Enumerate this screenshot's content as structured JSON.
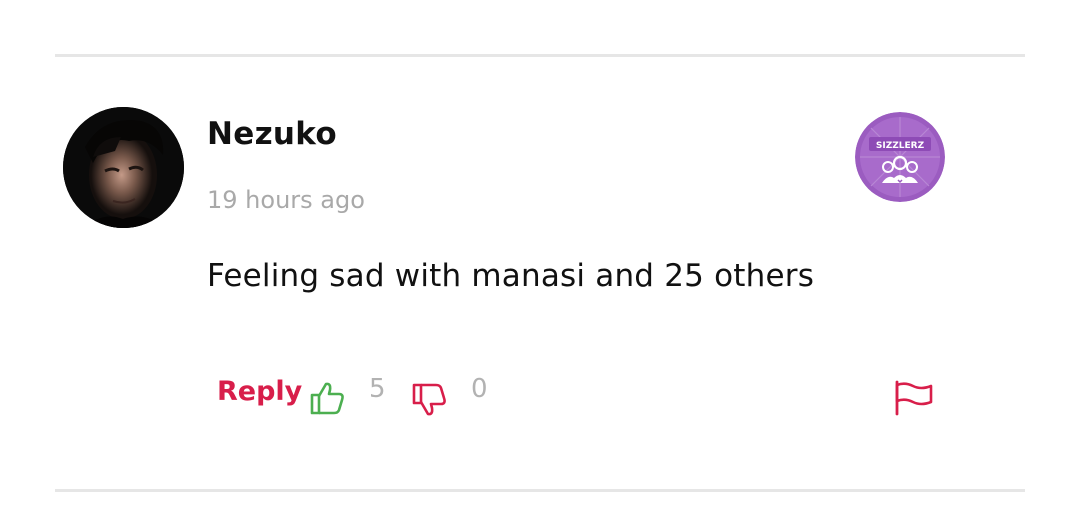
{
  "comment": {
    "username": "Nezuko",
    "timestamp": "19 hours ago",
    "text": "Feeling sad with manasi and 25 others",
    "badge_label": "SIZZLERZ",
    "avatar_icon": "user-avatar-photo"
  },
  "actions": {
    "reply_label": "Reply",
    "like_count": "5",
    "dislike_count": "0",
    "like_icon": "thumbs-up-icon",
    "dislike_icon": "thumbs-down-icon",
    "report_icon": "flag-icon"
  },
  "colors": {
    "accent": "#d81e4a",
    "like": "#4caf50",
    "badge": "#9b5cc0",
    "muted": "#a9a9a9",
    "divider": "#e6e6e6"
  }
}
